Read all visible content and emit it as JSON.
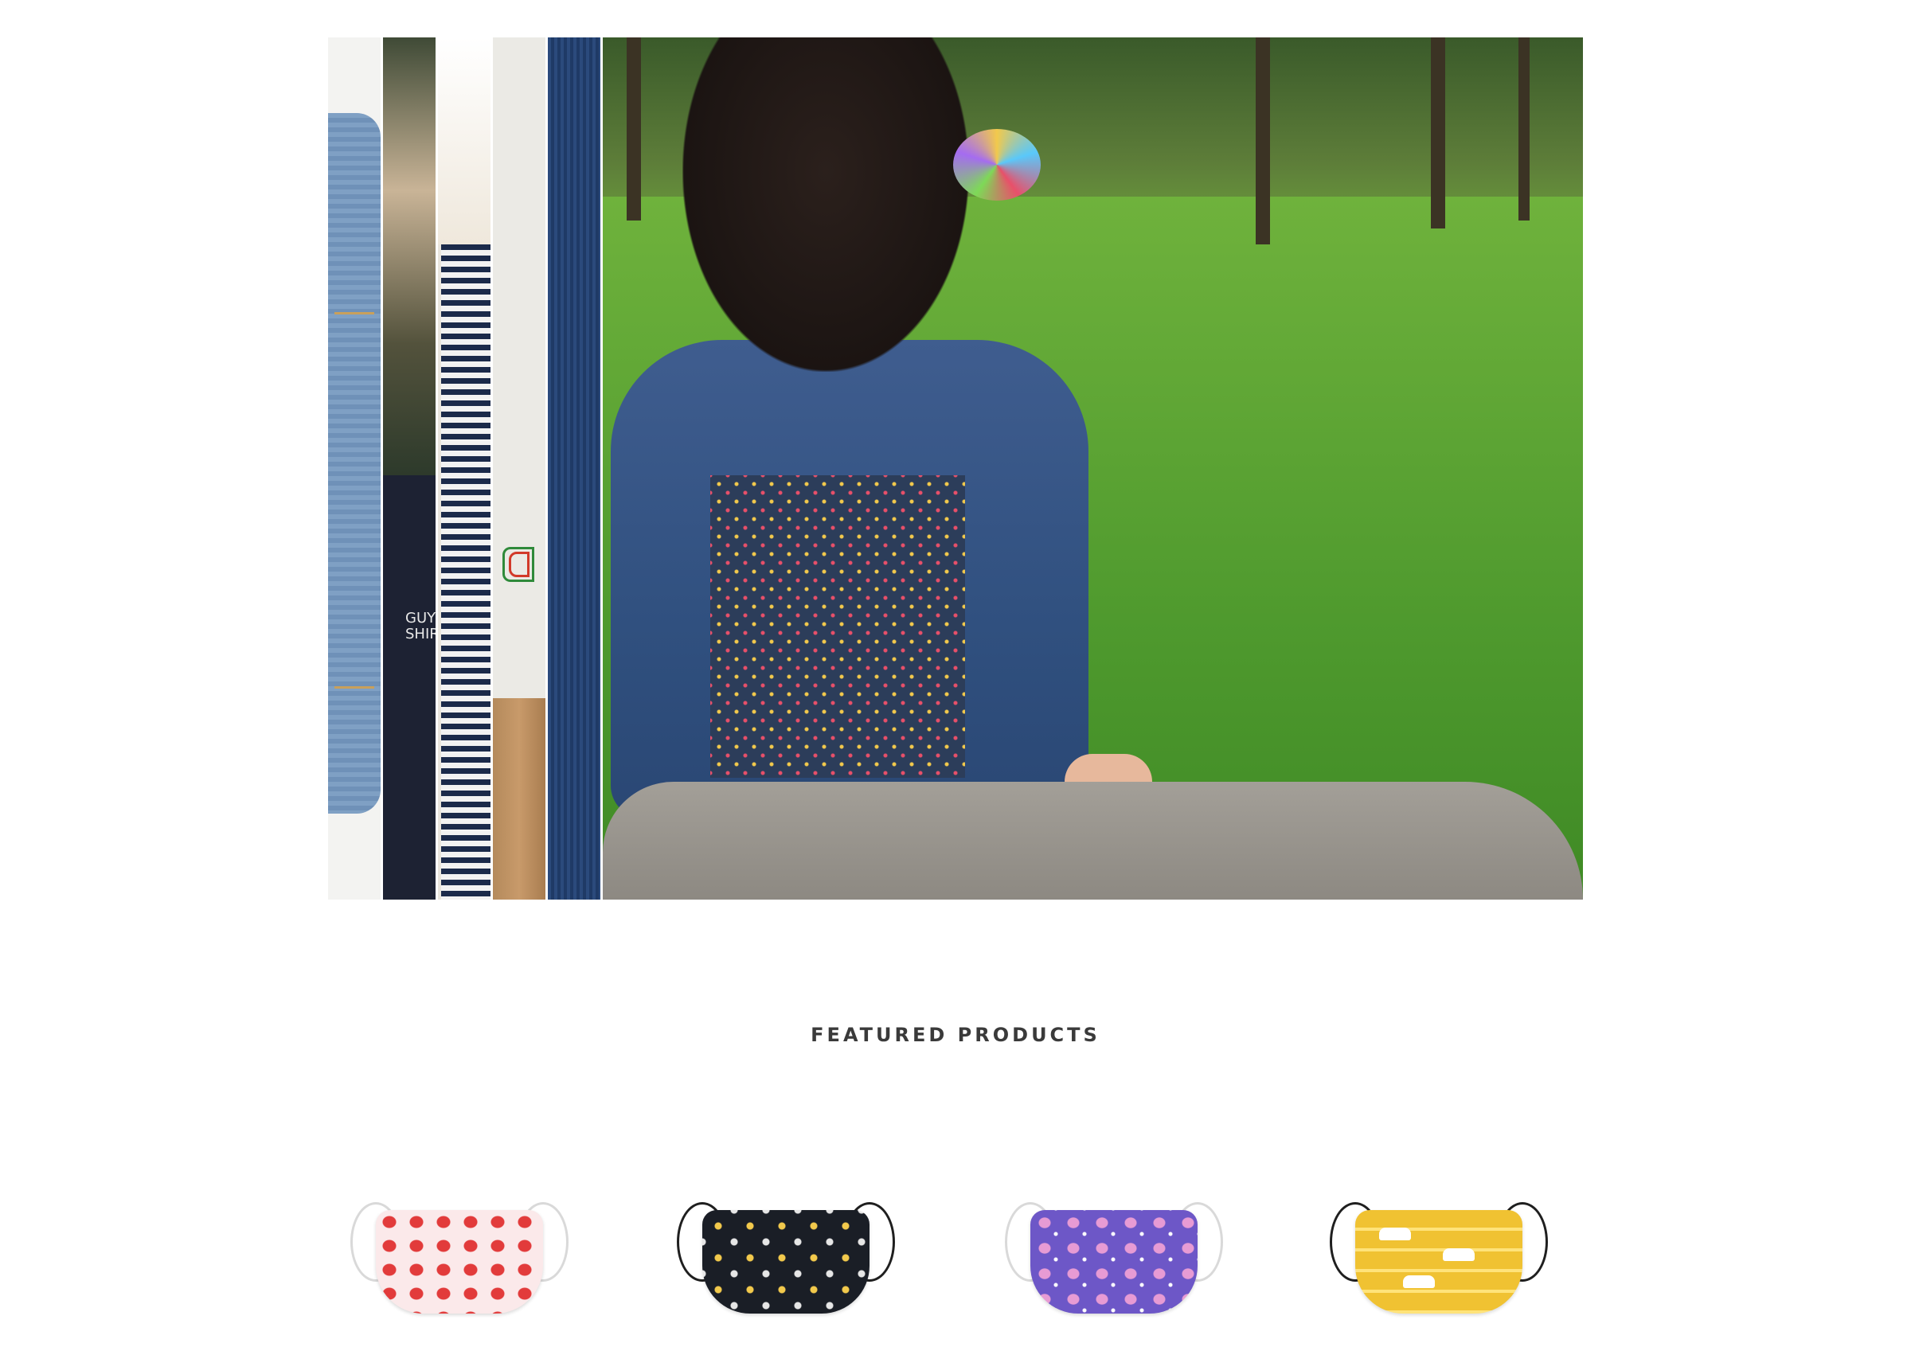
{
  "hero": {
    "main_slide_alt": "Child wearing an embroidered denim jacket sitting on a rock in a park",
    "collapsed_slides": [
      {
        "name": "denim-jacket"
      },
      {
        "name": "guy-shirt"
      },
      {
        "name": "striped-fabric"
      },
      {
        "name": "embroidered-canvas"
      },
      {
        "name": "dark-denim"
      }
    ],
    "slice2_text": "GUY\nSHIR"
  },
  "featured": {
    "title": "FEATURED PRODUCTS",
    "products": [
      {
        "name": "strawberry-print-mask",
        "pattern": "strawberry",
        "accent": "#e23b3b"
      },
      {
        "name": "vehicles-print-mask",
        "pattern": "vehicles",
        "accent": "#1a1e26"
      },
      {
        "name": "unicorn-print-mask",
        "pattern": "unicorn",
        "accent": "#6d57c7"
      },
      {
        "name": "taxi-print-mask",
        "pattern": "taxi",
        "accent": "#f0c232"
      }
    ]
  },
  "colors": {
    "background": "#ffffff",
    "title_text": "#3a3a3a"
  }
}
